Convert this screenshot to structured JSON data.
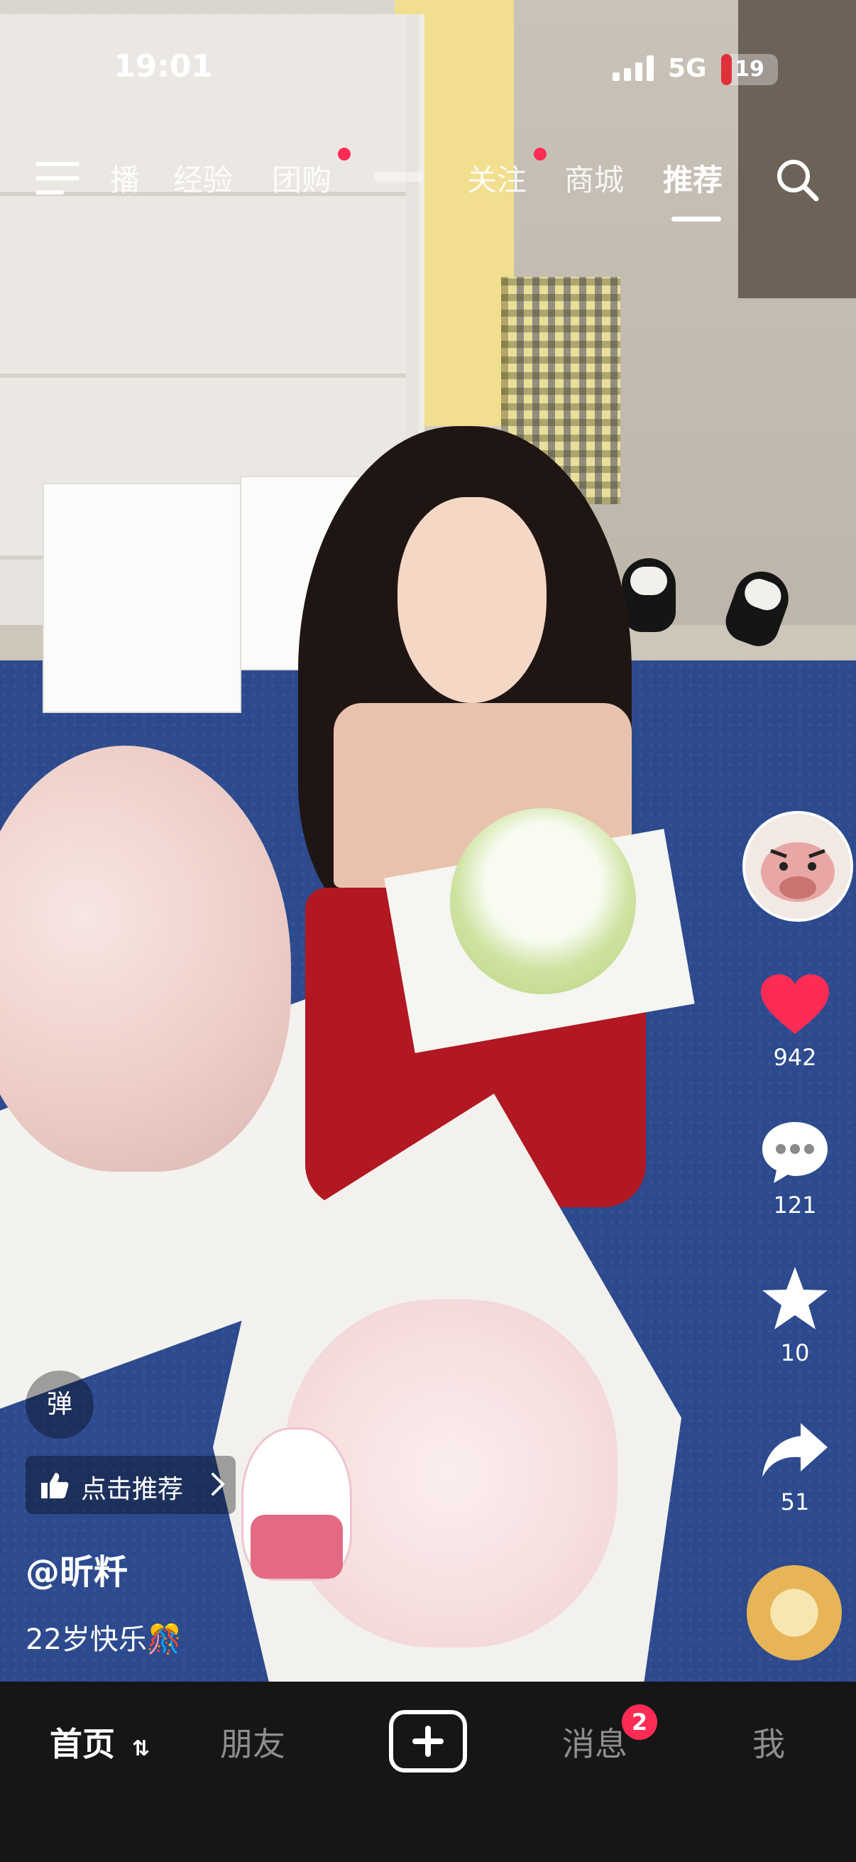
{
  "status_bar": {
    "time": "19:01",
    "network": "5G",
    "battery_level": "19"
  },
  "top_nav": {
    "tabs": [
      {
        "label": "播",
        "has_dot": false,
        "active": false
      },
      {
        "label": "经验",
        "has_dot": false,
        "active": false
      },
      {
        "label": "团购",
        "has_dot": true,
        "active": false
      },
      {
        "label": "关注",
        "has_dot": true,
        "active": false
      },
      {
        "label": "商城",
        "has_dot": false,
        "active": false
      },
      {
        "label": "推荐",
        "has_dot": false,
        "active": true
      }
    ],
    "menu_icon": "menu-icon",
    "search_icon": "search-icon"
  },
  "actions": {
    "likes": "942",
    "comments": "121",
    "favorites": "10",
    "shares": "51"
  },
  "video_info": {
    "danmu_label": "弹",
    "recommend_label": "点击推荐",
    "author": "@昕粁",
    "caption": "22岁快乐🎊"
  },
  "bottom_nav": {
    "home": "首页",
    "friends": "朋友",
    "messages": "消息",
    "messages_badge": "2",
    "me": "我"
  },
  "colors": {
    "accent": "#fe2c55",
    "bar_bg": "#161616"
  }
}
